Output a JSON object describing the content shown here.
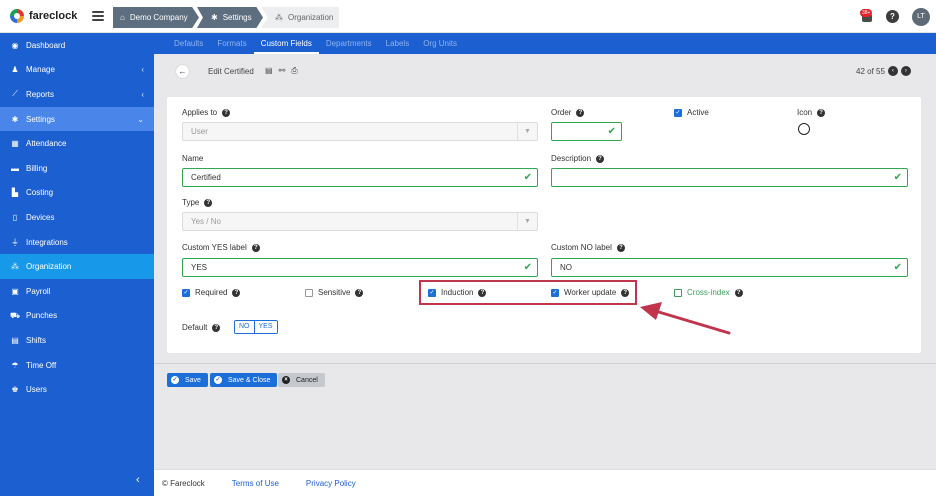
{
  "app": {
    "name": "fareclock"
  },
  "breadcrumbs": [
    {
      "label": "Demo Company",
      "icon": "home-icon"
    },
    {
      "label": "Settings",
      "icon": "gear-icon"
    },
    {
      "label": "Organization",
      "icon": "org-chart-icon"
    }
  ],
  "header": {
    "notification_badge": "38+",
    "help": "?",
    "avatar_initials": "LT"
  },
  "sidebar": {
    "items": [
      {
        "label": "Dashboard",
        "icon": "dashboard-icon"
      },
      {
        "label": "Manage",
        "icon": "user-icon",
        "chevron": "‹"
      },
      {
        "label": "Reports",
        "icon": "chart-icon",
        "chevron": "‹"
      },
      {
        "label": "Settings",
        "icon": "gear-icon",
        "chevron": "⌄"
      },
      {
        "label": "Attendance",
        "icon": "attendance-icon"
      },
      {
        "label": "Billing",
        "icon": "credit-card-icon"
      },
      {
        "label": "Costing",
        "icon": "bar-chart-icon"
      },
      {
        "label": "Devices",
        "icon": "tablet-icon"
      },
      {
        "label": "Integrations",
        "icon": "plug-icon"
      },
      {
        "label": "Organization",
        "icon": "sitemap-icon"
      },
      {
        "label": "Payroll",
        "icon": "money-icon"
      },
      {
        "label": "Punches",
        "icon": "truck-icon"
      },
      {
        "label": "Shifts",
        "icon": "calendar-icon"
      },
      {
        "label": "Time Off",
        "icon": "beach-icon"
      },
      {
        "label": "Users",
        "icon": "users-icon"
      }
    ],
    "collapse": "‹"
  },
  "subnav": {
    "tabs": [
      "Defaults",
      "Formats",
      "Custom Fields",
      "Departments",
      "Labels",
      "Org Units"
    ],
    "active": "Custom Fields"
  },
  "toolbar": {
    "back": "←",
    "title": "Edit Certified",
    "pager": "42 of 55",
    "prev": "‹",
    "next": "›"
  },
  "form": {
    "applies_to": {
      "label": "Applies to",
      "value": "User"
    },
    "order": {
      "label": "Order",
      "value": ""
    },
    "active": {
      "label": "Active",
      "checked": true
    },
    "icon": {
      "label": "Icon"
    },
    "name": {
      "label": "Name",
      "value": "Certified"
    },
    "description": {
      "label": "Description",
      "value": ""
    },
    "type": {
      "label": "Type",
      "value": "Yes / No"
    },
    "yes_label": {
      "label": "Custom YES label",
      "value": "YES"
    },
    "no_label": {
      "label": "Custom NO label",
      "value": "NO"
    },
    "checkboxes": {
      "required": {
        "label": "Required",
        "checked": true
      },
      "sensitive": {
        "label": "Sensitive",
        "checked": false
      },
      "induction": {
        "label": "Induction",
        "checked": true
      },
      "worker_update": {
        "label": "Worker update",
        "checked": true
      },
      "cross_index": {
        "label": "Cross-index",
        "checked": false
      }
    },
    "default": {
      "label": "Default",
      "options": [
        "NO",
        "YES"
      ]
    }
  },
  "actions": {
    "save": "Save",
    "save_close": "Save & Close",
    "cancel": "Cancel"
  },
  "footer": {
    "copyright": "© Fareclock",
    "terms": "Terms of Use",
    "privacy": "Privacy Policy"
  },
  "colors": {
    "primary": "#1c5fd1",
    "valid": "#2fa84f",
    "annotation": "#c0354b"
  }
}
